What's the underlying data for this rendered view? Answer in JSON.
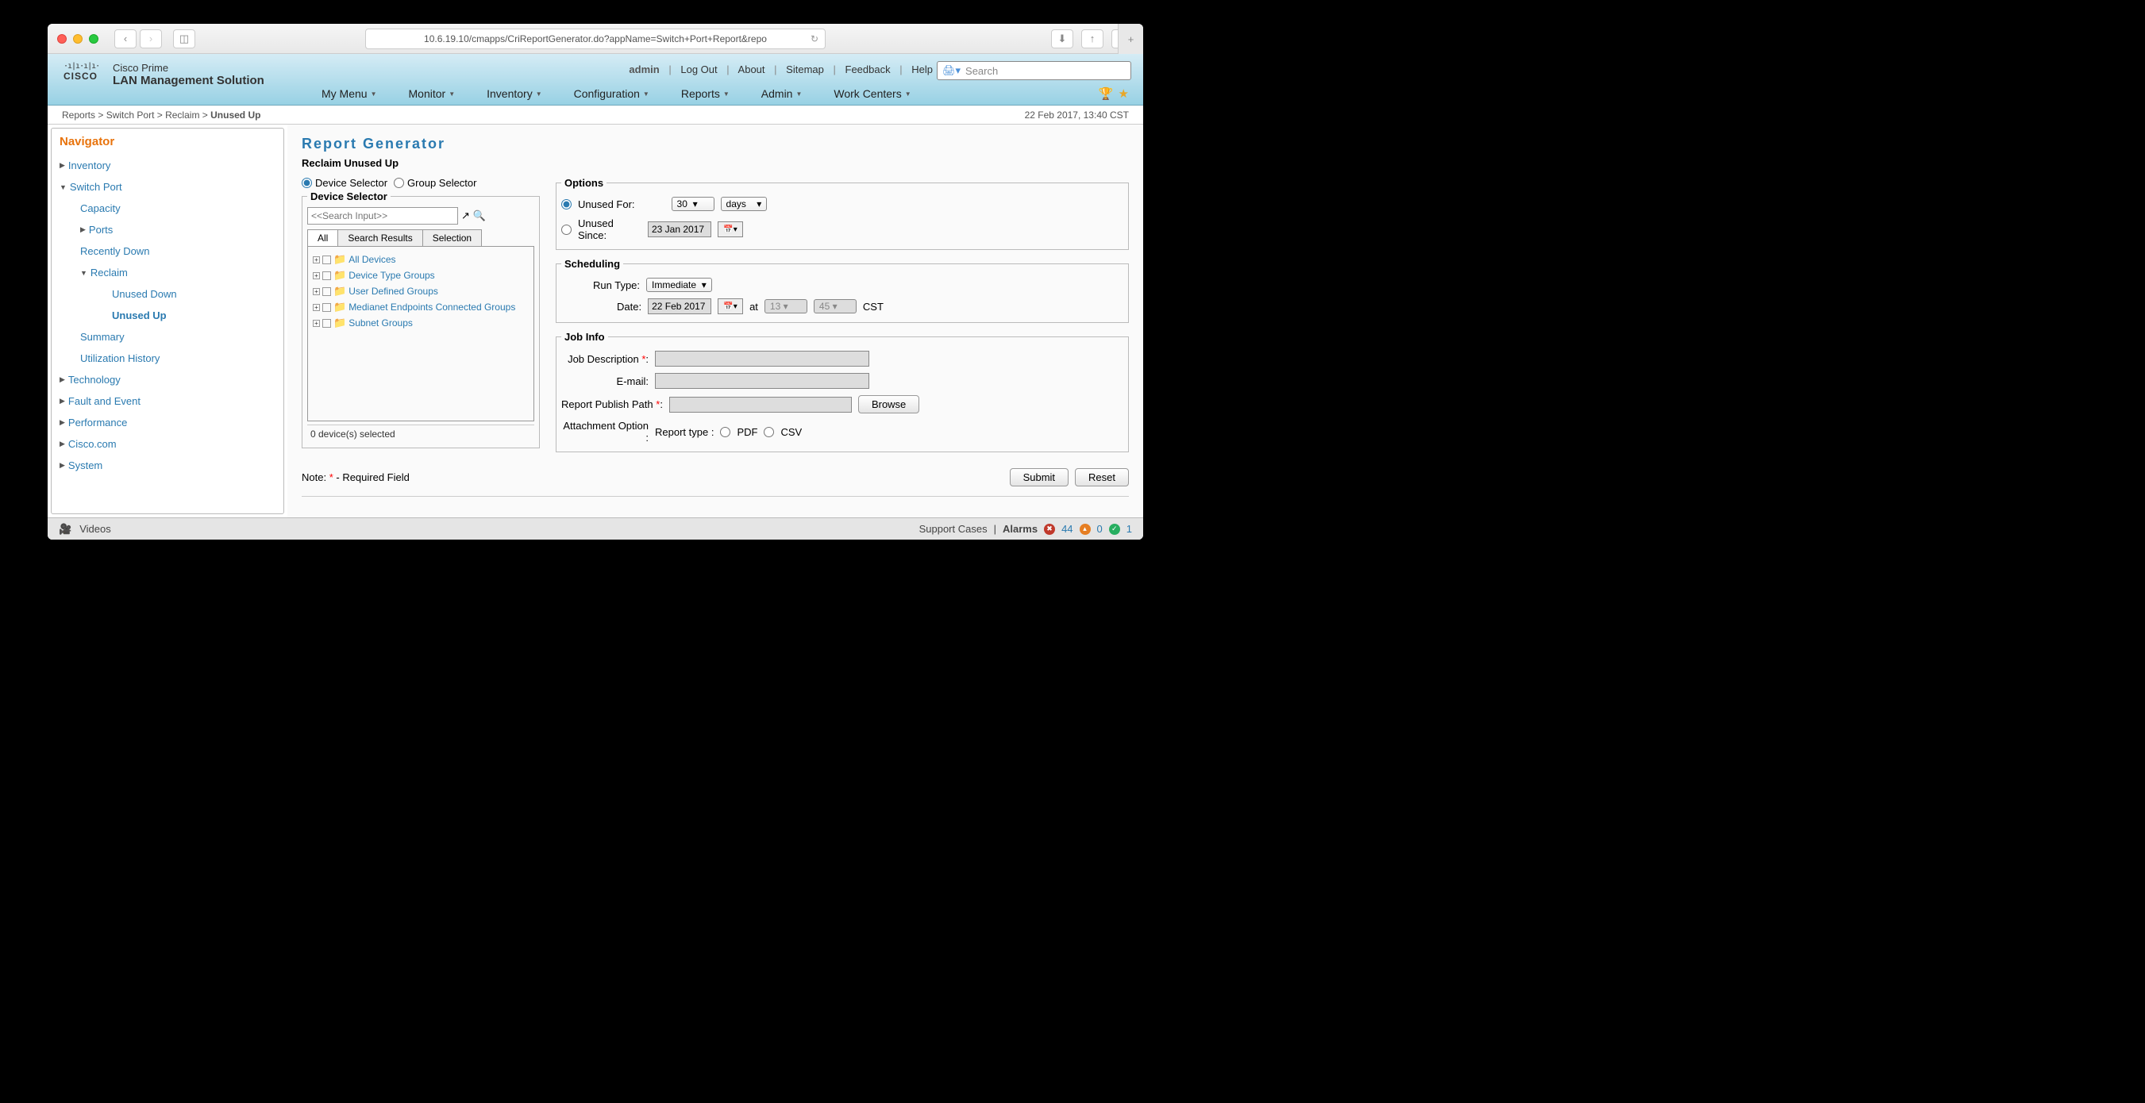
{
  "browser": {
    "url": "10.6.19.10/cmapps/CriReportGenerator.do?appName=Switch+Port+Report&repo"
  },
  "header": {
    "product_line1": "Cisco Prime",
    "product_line2": "LAN Management Solution",
    "user": "admin",
    "links": {
      "logout": "Log Out",
      "about": "About",
      "sitemap": "Sitemap",
      "feedback": "Feedback",
      "help": "Help"
    },
    "search_placeholder": "Search",
    "menus": [
      "My Menu",
      "Monitor",
      "Inventory",
      "Configuration",
      "Reports",
      "Admin",
      "Work Centers"
    ]
  },
  "breadcrumb": {
    "path": [
      "Reports",
      "Switch Port",
      "Reclaim"
    ],
    "current": "Unused Up",
    "timestamp": "22 Feb 2017, 13:40 CST"
  },
  "navigator": {
    "title": "Navigator",
    "items": {
      "inventory": "Inventory",
      "switchport": "Switch Port",
      "capacity": "Capacity",
      "ports": "Ports",
      "recently_down": "Recently Down",
      "reclaim": "Reclaim",
      "unused_down": "Unused Down",
      "unused_up": "Unused Up",
      "summary": "Summary",
      "util_hist": "Utilization History",
      "technology": "Technology",
      "fault": "Fault and Event",
      "performance": "Performance",
      "cisco": "Cisco.com",
      "system": "System"
    }
  },
  "main": {
    "title": "Report Generator",
    "subtitle": "Reclaim Unused Up",
    "selector": {
      "device_radio": "Device Selector",
      "group_radio": "Group Selector",
      "legend": "Device Selector",
      "search_placeholder": "<<Search Input>>",
      "tabs": {
        "all": "All",
        "results": "Search Results",
        "selection": "Selection"
      },
      "tree": [
        "All Devices",
        "Device Type Groups",
        "User Defined Groups",
        "Medianet Endpoints Connected Groups",
        "Subnet Groups"
      ],
      "selected_count": "0 device(s) selected"
    },
    "options": {
      "legend": "Options",
      "unused_for": "Unused For:",
      "unused_for_val": "30",
      "unused_for_unit": "days",
      "unused_since": "Unused Since:",
      "unused_since_date": "23 Jan 2017"
    },
    "scheduling": {
      "legend": "Scheduling",
      "runtype_label": "Run Type:",
      "runtype_val": "Immediate",
      "date_label": "Date:",
      "date_val": "22 Feb 2017",
      "at": "at",
      "hour": "13",
      "min": "45",
      "tz": "CST"
    },
    "jobinfo": {
      "legend": "Job Info",
      "desc": "Job Description",
      "email": "E-mail:",
      "pubpath": "Report Publish Path",
      "browse": "Browse",
      "attach": "Attachment Option :",
      "rtype": "Report type :",
      "pdf": "PDF",
      "csv": "CSV"
    },
    "note_label": "Note:",
    "note_text": " - Required Field",
    "submit": "Submit",
    "reset": "Reset"
  },
  "footer": {
    "videos": "Videos",
    "support": "Support Cases",
    "alarms": "Alarms",
    "counts": {
      "red": "44",
      "orange": "0",
      "green": "1"
    }
  }
}
